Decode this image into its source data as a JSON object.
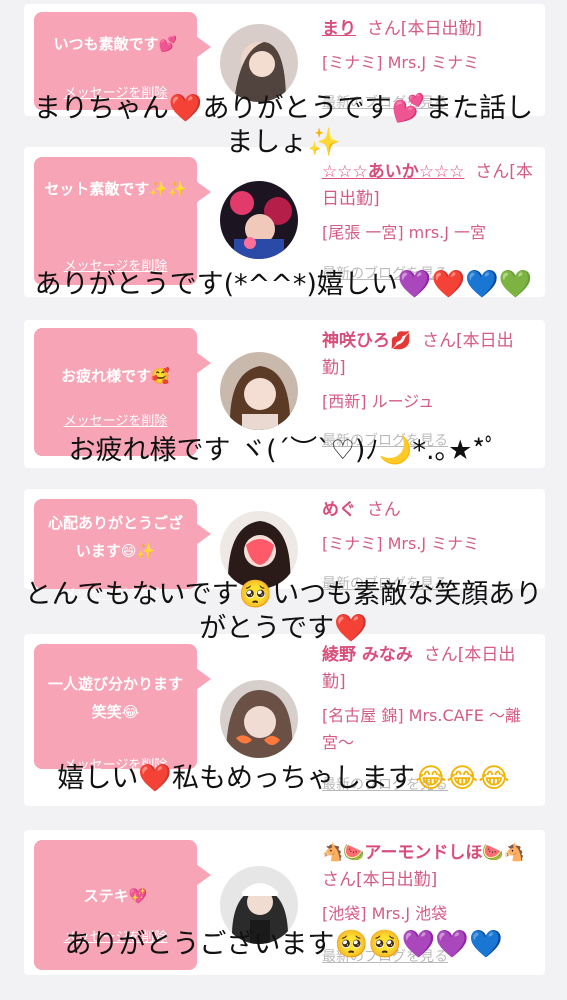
{
  "cards": [
    {
      "bubble_text": "いつも素敵です💕",
      "delete_label": "メッセージを削除",
      "name": "まり",
      "suffix": "さん[本日出勤]",
      "shop": "[ミナミ] Mrs.J ミナミ",
      "blog": "最新のブログを見る"
    },
    {
      "bubble_text": "セット素敵です✨✨",
      "delete_label": "メッセージを削除",
      "name": "☆☆☆あいか☆☆☆",
      "suffix": "さん[本日出勤]",
      "shop": "[尾張 一宮] mrs.J 一宮",
      "blog": "最新のブログを見る"
    },
    {
      "bubble_text": "お疲れ様です🥰",
      "delete_label": "メッセージを削除",
      "name": "神咲ひろ💋",
      "suffix": "さん[本日出勤]",
      "shop": "[西新] ルージュ",
      "blog": "最新のブログを見る"
    },
    {
      "bubble_text": "心配ありがとうございます😄✨",
      "delete_label": "メッセージを削除",
      "name": "めぐ",
      "suffix": "さん",
      "shop": "[ミナミ] Mrs.J ミナミ",
      "blog": "最新のブログを見る"
    },
    {
      "bubble_text": "一人遊び分かります笑笑😂",
      "delete_label": "メッセージを削除",
      "name": "綾野 みなみ",
      "suffix": "さん[本日出勤]",
      "shop": "[名古屋 錦] Mrs.CAFE 〜離宮〜",
      "blog": "最新のブログを見る"
    },
    {
      "bubble_text": "ステキ💖",
      "delete_label": "メッセージを削除",
      "name": "🐴🍉アーモンドしほ🍉🐴",
      "suffix": "さん[本日出勤]",
      "shop": "[池袋] Mrs.J 池袋",
      "blog": "最新のブログを見る"
    }
  ],
  "replies": [
    {
      "line1": "まりちゃん",
      "e1": "❤️",
      "line1b": "ありがとうです",
      "e2": "💕",
      "line1c": "また話し",
      "line2": "ましょ",
      "e3": "✨"
    },
    {
      "text": "ありがとうです(*^^*)嬉しい",
      "e1": "💜",
      "e2": "❤️",
      "e3": "💙",
      "e4": "💚"
    },
    {
      "text": "お疲れ様です ヾ(´︶`♡)ﾉ",
      "e1": "🌙",
      "tail": "*.｡★*ﾟ"
    },
    {
      "line1": "とんでもないです",
      "e1": "🥺",
      "line1b": "いつも素敵な笑顔あり",
      "line2": "がとうです",
      "e2": "❤️"
    },
    {
      "text": "嬉しい",
      "e1": "❤️",
      "text2": "私もめっちゃします",
      "e2": "😂",
      "e3": "😂",
      "e4": "😂"
    },
    {
      "text": "ありがとうございます",
      "e1": "🥺",
      "e2": "🥺",
      "e3": "💜",
      "e4": "💜",
      "e5": "💙"
    }
  ],
  "colors": {
    "bubble": "#f7a4b6",
    "name": "#d94d7a",
    "text_pink": "#d45c84",
    "link_gray": "#bbbbbb"
  }
}
